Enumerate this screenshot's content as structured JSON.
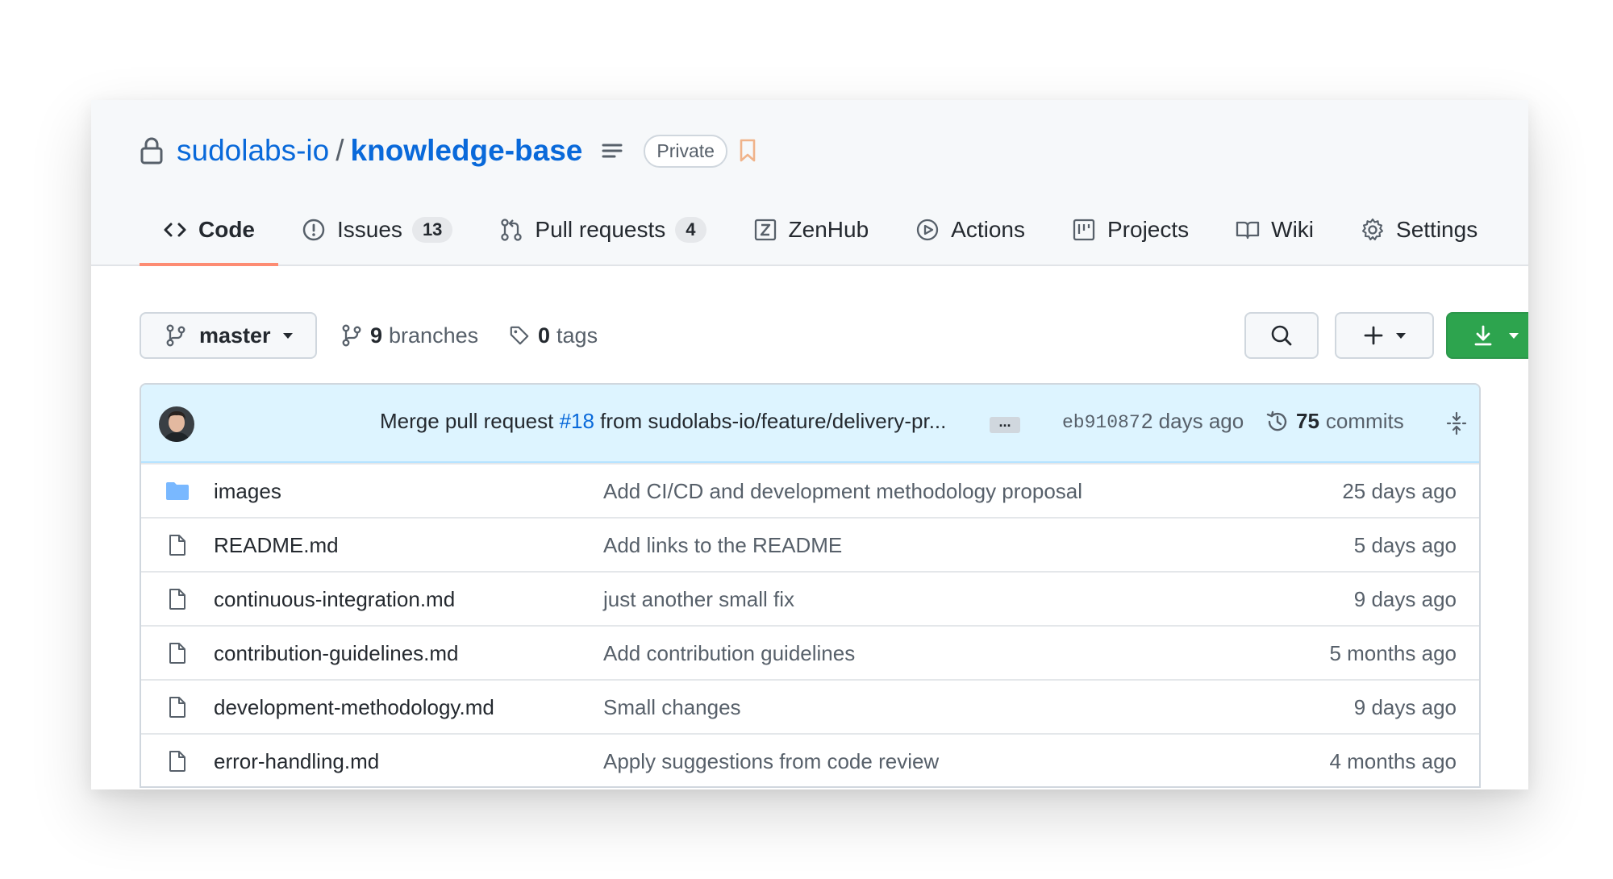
{
  "repo": {
    "owner": "sudolabs-io",
    "separator": "/",
    "name": "knowledge-base",
    "visibility": "Private",
    "icons": {
      "lock": "lock-icon",
      "description": "three-bars-icon",
      "bookmark": "bookmark-icon"
    }
  },
  "tabs": [
    {
      "label": "Code",
      "icon": "code-icon",
      "active": true
    },
    {
      "label": "Issues",
      "icon": "issue-opened-icon",
      "count": "13"
    },
    {
      "label": "Pull requests",
      "icon": "git-pull-request-icon",
      "count": "4"
    },
    {
      "label": "ZenHub",
      "icon": "zenhub-icon"
    },
    {
      "label": "Actions",
      "icon": "play-icon"
    },
    {
      "label": "Projects",
      "icon": "project-icon"
    },
    {
      "label": "Wiki",
      "icon": "book-icon"
    },
    {
      "label": "Settings",
      "icon": "gear-icon"
    }
  ],
  "toolbar": {
    "branch": "master",
    "branches_count": "9",
    "branches_label": "branches",
    "tags_count": "0",
    "tags_label": "tags"
  },
  "latest_commit": {
    "message_prefix": "Merge pull request ",
    "pr_link": "#18",
    "message_suffix": " from sudolabs-io/feature/delivery-pr...",
    "ellipsis": "...",
    "sha": "eb91087",
    "age": "2 days ago",
    "commits_count": "75",
    "commits_label": "commits"
  },
  "files": [
    {
      "type": "folder",
      "name": "images",
      "message": "Add CI/CD and development methodology proposal",
      "age": "25 days ago"
    },
    {
      "type": "file",
      "name": "README.md",
      "message": "Add links to the README",
      "age": "5 days ago"
    },
    {
      "type": "file",
      "name": "continuous-integration.md",
      "message": "just another small fix",
      "age": "9 days ago"
    },
    {
      "type": "file",
      "name": "contribution-guidelines.md",
      "message": "Add contribution guidelines",
      "age": "5 months ago"
    },
    {
      "type": "file",
      "name": "development-methodology.md",
      "message": "Small changes",
      "age": "9 days ago"
    },
    {
      "type": "file",
      "name": "error-handling.md",
      "message": "Apply suggestions from code review",
      "age": "4 months ago"
    }
  ],
  "colors": {
    "link": "#0969da",
    "active_tab_underline": "#fd8c73",
    "code_button": "#2da44e",
    "commit_bar": "#ddf4ff",
    "folder_icon": "#79b8ff"
  }
}
